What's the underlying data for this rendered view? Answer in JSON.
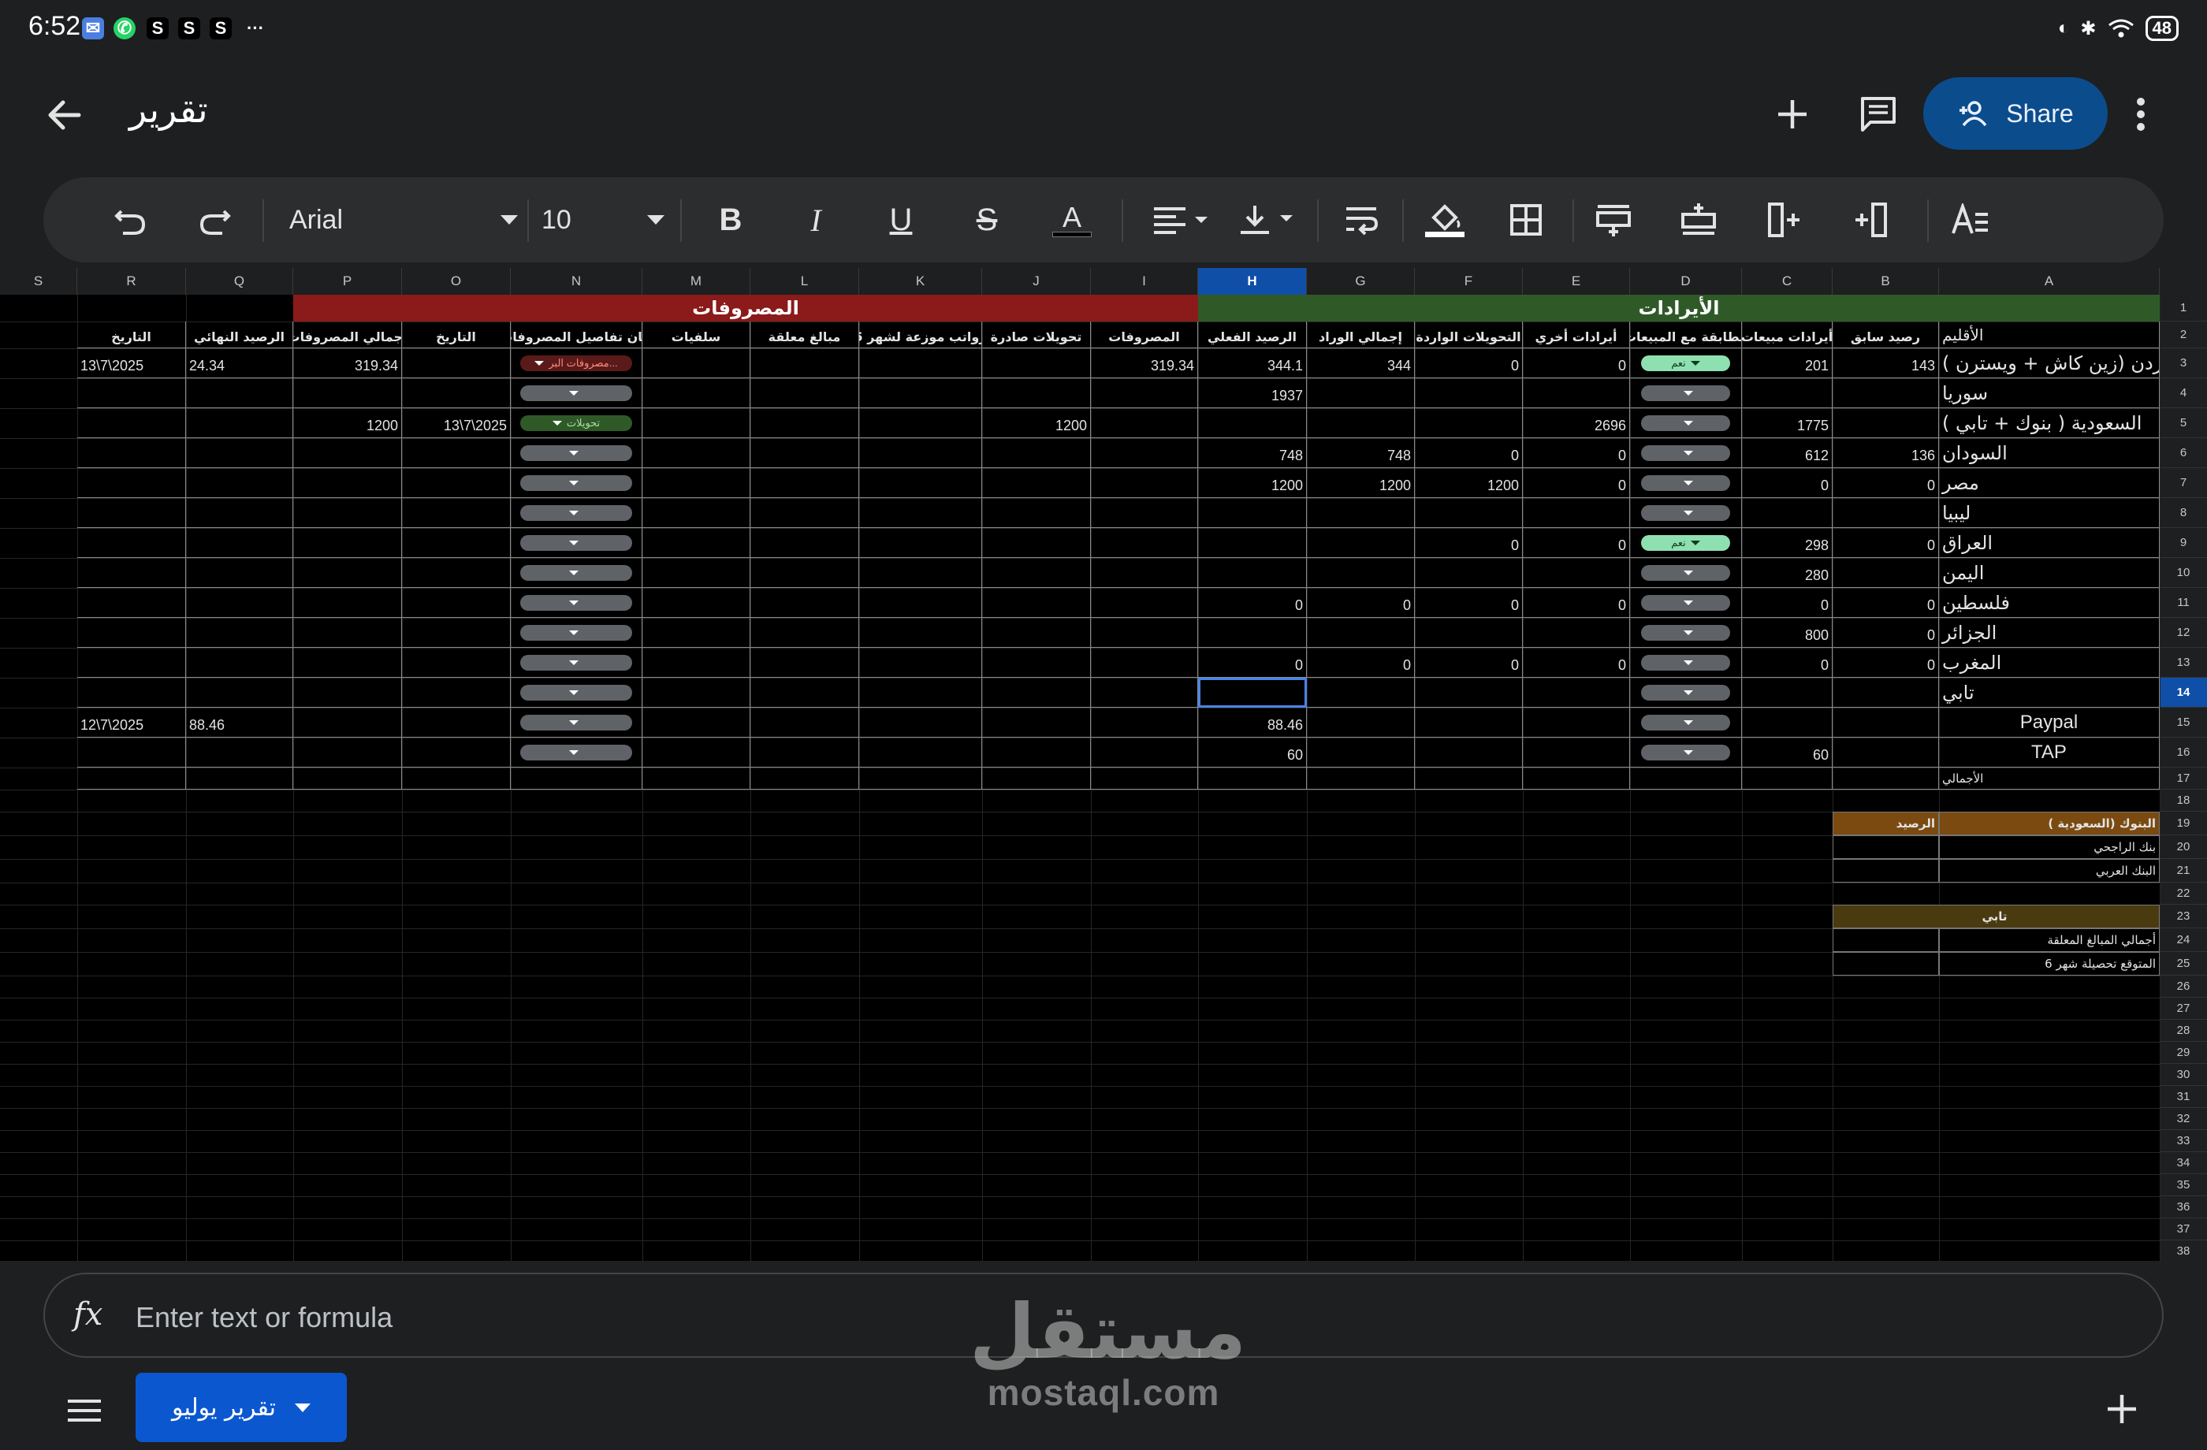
{
  "status_bar": {
    "time": "6:52",
    "notifications": [
      "S",
      "S",
      "S"
    ],
    "more": "···",
    "battery": "48"
  },
  "title_bar": {
    "doc_title": "تقرير",
    "share_label": "Share"
  },
  "toolbar": {
    "font": "Arial",
    "font_size": "10"
  },
  "columns": [
    "S",
    "R",
    "Q",
    "P",
    "O",
    "N",
    "M",
    "L",
    "K",
    "J",
    "I",
    "H",
    "G",
    "F",
    "E",
    "D",
    "C",
    "B",
    "A"
  ],
  "selected_column": "H",
  "rows": [
    "1",
    "2",
    "3",
    "4",
    "5",
    "6",
    "7",
    "8",
    "9",
    "10",
    "11",
    "12",
    "13",
    "14",
    "15",
    "16",
    "17",
    "18",
    "19",
    "20",
    "21",
    "22",
    "23",
    "24",
    "25",
    "26",
    "27",
    "28",
    "29",
    "30",
    "31",
    "32",
    "33",
    "34",
    "35",
    "36",
    "37",
    "38"
  ],
  "selected_row": "14",
  "band_headers": {
    "expenses": "المصروفات",
    "revenues": "الأيرادات"
  },
  "headers": {
    "R": "التاريخ",
    "Q": "الرصيد النهائي",
    "P": "أجمالي المصروفات",
    "O": "التاريخ",
    "N": "بيان تفاصيل المصروفات",
    "M": "سلفيات",
    "L": "مبالغ معلقة",
    "K": "رواتب موزعة لشهر 5",
    "J": "تحويلات صادرة",
    "I": "المصروفات",
    "H": "الرصيد الفعلي",
    "G": "إجمالي الوراد",
    "F": "التحويلات الواردة",
    "E": "أيرادات أخري",
    "D": "مطابقة مع المبيعات",
    "C": "أيرادات مبيعات",
    "B": "رصيد سابق",
    "A": "الأقليم"
  },
  "table_rows": [
    {
      "A": "الأردن (زين كاش + ويسترن )",
      "B": "143",
      "C": "201",
      "D_chip": "نعم",
      "E": "0",
      "F": "0",
      "G": "344",
      "H": "344.1",
      "I": "319.34",
      "J": "",
      "N_chip": "مصروفات البر...",
      "O": "",
      "P": "319.34",
      "Q": "24.34",
      "R": "13\\7\\2025"
    },
    {
      "A": "سوريا",
      "B": "",
      "C": "",
      "D_chip": "",
      "E": "",
      "F": "",
      "G": "",
      "H": "1937",
      "I": "",
      "J": "",
      "N_chip": "",
      "O": "",
      "P": "",
      "Q": "",
      "R": ""
    },
    {
      "A": "السعودية ( بنوك + تابي )",
      "B": "",
      "C": "1775",
      "D_chip": "",
      "E": "2696",
      "F": "",
      "G": "",
      "H": "",
      "I": "",
      "J": "1200",
      "N_chip": "تحويلات",
      "O": "13\\7\\2025",
      "P": "1200",
      "Q": "",
      "R": ""
    },
    {
      "A": "السودان",
      "B": "136",
      "C": "612",
      "D_chip": "",
      "E": "0",
      "F": "0",
      "G": "748",
      "H": "748",
      "I": "",
      "J": "",
      "N_chip": "",
      "O": "",
      "P": "",
      "Q": "",
      "R": ""
    },
    {
      "A": "مصر",
      "B": "0",
      "C": "0",
      "D_chip": "",
      "E": "0",
      "F": "1200",
      "G": "1200",
      "H": "1200",
      "I": "",
      "J": "",
      "N_chip": "",
      "O": "",
      "P": "",
      "Q": "",
      "R": ""
    },
    {
      "A": "ليبيا",
      "B": "",
      "C": "",
      "D_chip": "",
      "E": "",
      "F": "",
      "G": "",
      "H": "",
      "I": "",
      "J": "",
      "N_chip": "",
      "O": "",
      "P": "",
      "Q": "",
      "R": ""
    },
    {
      "A": "العراق",
      "B": "0",
      "C": "298",
      "D_chip": "نعم",
      "E": "0",
      "F": "0",
      "G": "",
      "H": "",
      "I": "",
      "J": "",
      "N_chip": "",
      "O": "",
      "P": "",
      "Q": "",
      "R": ""
    },
    {
      "A": "اليمن",
      "B": "",
      "C": "280",
      "D_chip": "",
      "E": "",
      "F": "",
      "G": "",
      "H": "",
      "I": "",
      "J": "",
      "N_chip": "",
      "O": "",
      "P": "",
      "Q": "",
      "R": ""
    },
    {
      "A": "فلسطين",
      "B": "0",
      "C": "0",
      "D_chip": "",
      "E": "0",
      "F": "0",
      "G": "0",
      "H": "0",
      "I": "",
      "J": "",
      "N_chip": "",
      "O": "",
      "P": "",
      "Q": "",
      "R": ""
    },
    {
      "A": "الجزائر",
      "B": "0",
      "C": "800",
      "D_chip": "",
      "E": "",
      "F": "",
      "G": "",
      "H": "",
      "I": "",
      "J": "",
      "N_chip": "",
      "O": "",
      "P": "",
      "Q": "",
      "R": ""
    },
    {
      "A": "المغرب",
      "B": "0",
      "C": "0",
      "D_chip": "",
      "E": "0",
      "F": "0",
      "G": "0",
      "H": "0",
      "I": "",
      "J": "",
      "N_chip": "",
      "O": "",
      "P": "",
      "Q": "",
      "R": ""
    },
    {
      "A": "تابي",
      "B": "",
      "C": "",
      "D_chip": "",
      "E": "",
      "F": "",
      "G": "",
      "H": "",
      "I": "",
      "J": "",
      "N_chip": "",
      "O": "",
      "P": "",
      "Q": "",
      "R": ""
    },
    {
      "A": "Paypal",
      "B": "",
      "C": "",
      "D_chip": "",
      "E": "",
      "F": "",
      "G": "",
      "H": "88.46",
      "I": "",
      "J": "",
      "N_chip": "",
      "O": "",
      "P": "",
      "Q": "88.46",
      "R": "12\\7\\2025"
    },
    {
      "A": "TAP",
      "B": "",
      "C": "60",
      "D_chip": "",
      "E": "",
      "F": "",
      "G": "",
      "H": "60",
      "I": "",
      "J": "",
      "N_chip": "",
      "O": "",
      "P": "",
      "Q": "",
      "R": ""
    }
  ],
  "total_label": "الأجمالي",
  "banks_table": {
    "title": "البنوك (السعودية )",
    "balance_label": "الرصيد",
    "rows": [
      "بنك الراجحي",
      "البنك العربي"
    ]
  },
  "tabby_table": {
    "title": "تابي",
    "rows": [
      "أجمالي المبالغ المعلقة",
      "المتوقع تحصيلة شهر 6"
    ]
  },
  "formula_bar": {
    "fx": "fx",
    "placeholder": "Enter text or formula"
  },
  "sheet_tab": {
    "label": "تقرير يوليو"
  },
  "watermark": {
    "arabic": "مستقل",
    "latin": "mostaql.com"
  },
  "colors": {
    "expenses_band": "#8b1a1a",
    "revenues_band": "#2f5a28",
    "chip_yes": "#8fe0b0",
    "chip_expense": "#5a1a1a",
    "chip_transfer": "#2f5a28",
    "banks_header": "#7a4a10",
    "tabby_header": "#4a3a10",
    "accent": "#0b57d0"
  }
}
